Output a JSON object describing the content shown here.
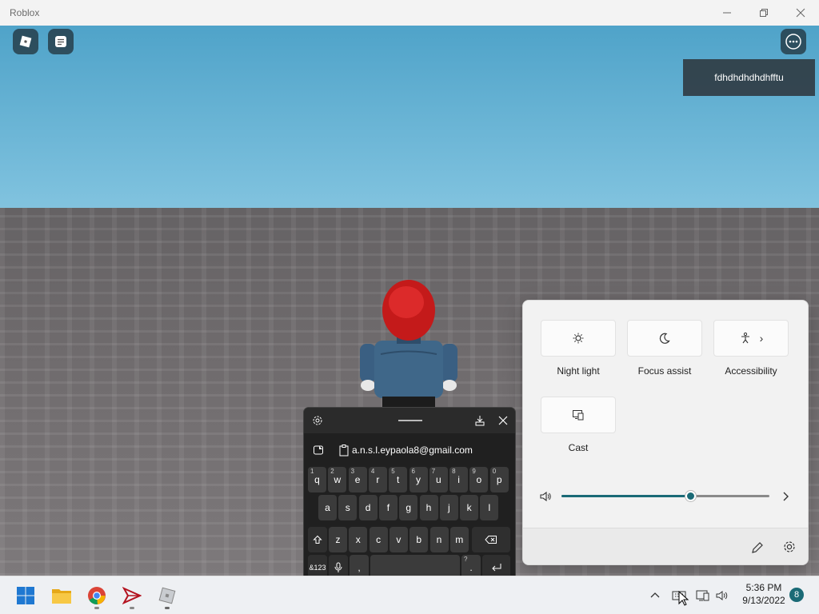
{
  "window": {
    "title": "Roblox",
    "minimize_icon": "minimize-icon",
    "maximize_icon": "restore-icon",
    "close_icon": "close-icon"
  },
  "game": {
    "menu_icon": "roblox-logo-icon",
    "chat_icon": "chat-icon",
    "more_icon": "more-options-icon",
    "toast_text": "fdhdhdhdhdhfftu"
  },
  "quick_settings": {
    "tiles": [
      {
        "label": "Night light",
        "icon": "night-light-icon"
      },
      {
        "label": "Focus assist",
        "icon": "focus-assist-icon"
      },
      {
        "label": "Accessibility",
        "icon": "accessibility-icon",
        "chevron": "›"
      },
      {
        "label": "Cast",
        "icon": "cast-icon"
      }
    ],
    "volume_level": 0.62,
    "volume_icon": "speaker-icon",
    "edit_icon": "pencil-icon",
    "settings_icon": "gear-icon"
  },
  "touch_keyboard": {
    "clipboard_suggestion": "a.n.s.l.eypaola8@gmail.com",
    "row1": [
      {
        "k": "q",
        "n": "1"
      },
      {
        "k": "w",
        "n": "2"
      },
      {
        "k": "e",
        "n": "3"
      },
      {
        "k": "r",
        "n": "4"
      },
      {
        "k": "t",
        "n": "5"
      },
      {
        "k": "y",
        "n": "6"
      },
      {
        "k": "u",
        "n": "7"
      },
      {
        "k": "i",
        "n": "8"
      },
      {
        "k": "o",
        "n": "9"
      },
      {
        "k": "p",
        "n": "0"
      }
    ],
    "row2": [
      "a",
      "s",
      "d",
      "f",
      "g",
      "h",
      "j",
      "k",
      "l"
    ],
    "row3": [
      "z",
      "x",
      "c",
      "v",
      "b",
      "n",
      "m"
    ],
    "mode_key": "&123",
    "comma": ",",
    "period": ".",
    "period_alt": "?"
  },
  "taskbar": {
    "apps": [
      "start-icon",
      "file-explorer-icon",
      "chrome-icon",
      "arrow-app-icon",
      "roblox-app-icon"
    ],
    "time": "5:36 PM",
    "date": "9/13/2022",
    "notification_count": "8"
  },
  "colors": {
    "accent": "#1a6a76",
    "roblox_red": "#c41a1a",
    "jacket_blue": "#3a5f82"
  }
}
